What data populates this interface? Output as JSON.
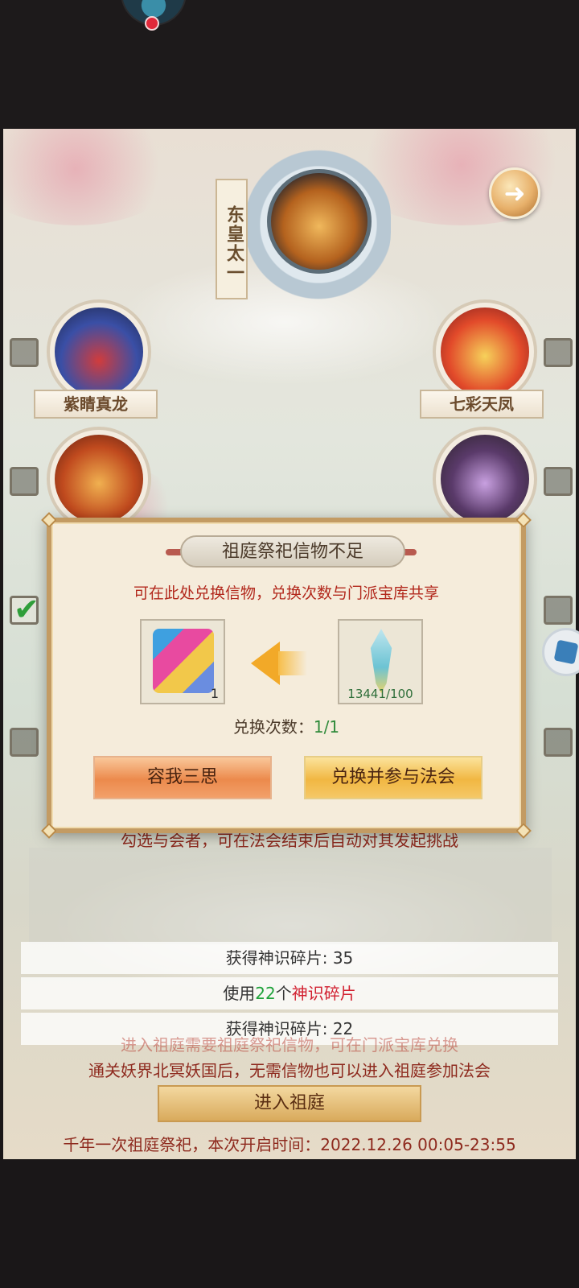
{
  "boss": {
    "name": "东皇太一"
  },
  "heroes": [
    {
      "name": "紫睛真龙"
    },
    {
      "name": "七彩天凤"
    }
  ],
  "dialog": {
    "title": "祖庭祭祀信物不足",
    "subtitle": "可在此处兑换信物，兑换次数与门派宝库共享",
    "from_item_count": "1",
    "to_item_progress": "13441/100",
    "exchange_label": "兑换次数：",
    "exchange_value": "1/1",
    "cancel_label": "容我三思",
    "confirm_label": "兑换并参与法会"
  },
  "under_dialog_text": "勾选与会者，可在法会结束后自动对其发起挑战",
  "log": {
    "row1": "获得神识碎片: 35",
    "row2_prefix": "使用",
    "row2_number": "22",
    "row2_middle": "个",
    "row2_suffix": "神识碎片",
    "row3": "获得神识碎片: 22"
  },
  "info_line1": "进入祖庭需要祖庭祭祀信物，可在门派宝库兑换",
  "info_line2": "通关妖界北冥妖国后，无需信物也可以进入祖庭参加法会",
  "enter_button": "进入祖庭",
  "footer": "千年一次祖庭祭祀，本次开启时间：2022.12.26 00:05-23:55",
  "icons": [
    "back-arrow-icon",
    "side-cube-icon",
    "checkmark-icon"
  ],
  "colors": {
    "accent_red": "#8e2a1e",
    "progress_green": "#2f8a3a",
    "highlight_red": "#d22030"
  }
}
